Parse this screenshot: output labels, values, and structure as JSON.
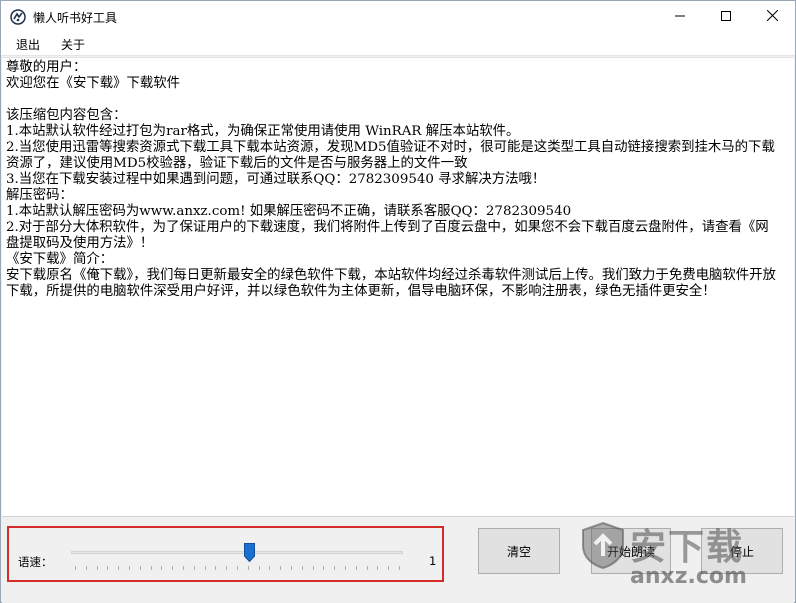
{
  "window": {
    "title": "懒人听书好工具"
  },
  "menu": {
    "exit": "退出",
    "about": "关于"
  },
  "content": {
    "text": "尊敬的用户：\n欢迎您在《安下载》下载软件\n\n该压缩包内容包含：\n1.本站默认软件经过打包为rar格式，为确保正常使用请使用 WinRAR 解压本站软件。\n2.当您使用迅雷等搜索资源式下载工具下载本站资源，发现MD5值验证不对时，很可能是这类型工具自动链接搜索到挂木马的下载资源了，建议使用MD5校验器，验证下载后的文件是否与服务器上的文件一致\n3.当您在下载安装过程中如果遇到问题，可通过联系QQ：2782309540 寻求解决方法哦！\n解压密码：\n1.本站默认解压密码为www.anxz.com! 如果解压密码不正确，请联系客服QQ：2782309540\n2.对于部分大体积软件，为了保证用户的下载速度，我们将附件上传到了百度云盘中，如果您不会下载百度云盘附件，请查看《网盘提取码及使用方法》！\n《安下载》简介：\n安下载原名《俺下载》，我们每日更新最安全的绿色软件下载，本站软件均经过杀毒软件测试后上传。我们致力于免费电脑软件开放下载，所提供的电脑软件深受用户好评，并以绿色软件为主体更新，倡导电脑环保，不影响注册表，绿色无插件更安全！"
  },
  "controls": {
    "speed_label": "语速：",
    "speed_value": "1",
    "speed_level": 0.54,
    "clear_label": "清空",
    "start_label": "开始朗读",
    "stop_label": "停止"
  },
  "watermark": {
    "brand": "安下载",
    "url": "anxz.com"
  },
  "colors": {
    "highlight_border": "#d42b2b",
    "slider_thumb": "#1a6fd0"
  },
  "icons": {
    "app": "app-icon",
    "minimize": "minimize-icon",
    "maximize": "maximize-icon",
    "close": "close-icon",
    "watermark_logo": "shield-logo-icon"
  }
}
